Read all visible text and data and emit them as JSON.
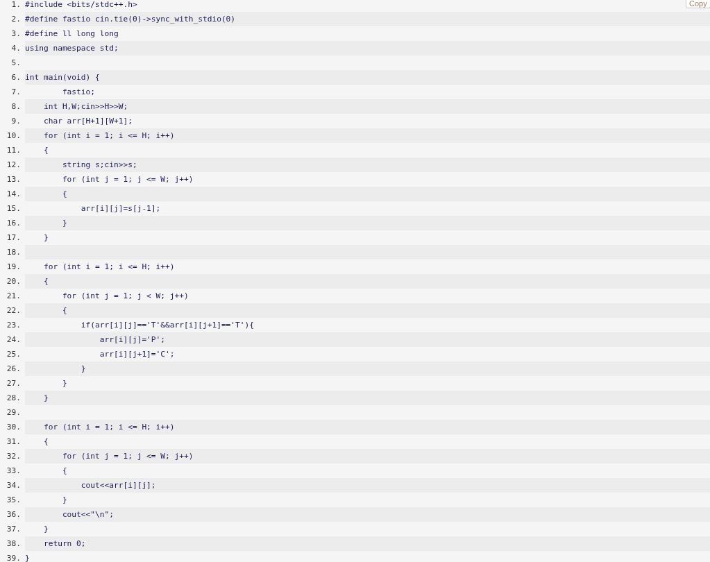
{
  "copy_button": {
    "label": "Copy"
  },
  "lines": [
    {
      "number": "1.",
      "code": "#include <bits/stdc++.h>"
    },
    {
      "number": "2.",
      "code": "#define fastio cin.tie(0)->sync_with_stdio(0)"
    },
    {
      "number": "3.",
      "code": "#define ll long long"
    },
    {
      "number": "4.",
      "code": "using namespace std;"
    },
    {
      "number": "5."
    },
    {
      "number": "6.",
      "code": "int main(void) {"
    },
    {
      "number": "7.",
      "code": "        fastio;"
    },
    {
      "number": "8.",
      "code": "    int H,W;cin>>H>>W;"
    },
    {
      "number": "9.",
      "code": "    char arr[H+1][W+1];"
    },
    {
      "number": "10.",
      "code": "    for (int i = 1; i <= H; i++)"
    },
    {
      "number": "11.",
      "code": "    {"
    },
    {
      "number": "12.",
      "code": "        string s;cin>>s;"
    },
    {
      "number": "13.",
      "code": "        for (int j = 1; j <= W; j++)"
    },
    {
      "number": "14.",
      "code": "        {"
    },
    {
      "number": "15.",
      "code": "            arr[i][j]=s[j-1];"
    },
    {
      "number": "16.",
      "code": "        }"
    },
    {
      "number": "17.",
      "code": "    }"
    },
    {
      "number": "18."
    },
    {
      "number": "19.",
      "code": "    for (int i = 1; i <= H; i++)"
    },
    {
      "number": "20.",
      "code": "    {"
    },
    {
      "number": "21.",
      "code": "        for (int j = 1; j < W; j++)"
    },
    {
      "number": "22.",
      "code": "        {"
    },
    {
      "number": "23.",
      "code": "            if(arr[i][j]=='T'&&arr[i][j+1]=='T'){"
    },
    {
      "number": "24.",
      "code": "                arr[i][j]='P';"
    },
    {
      "number": "25.",
      "code": "                arr[i][j+1]='C';"
    },
    {
      "number": "26.",
      "code": "            }"
    },
    {
      "number": "27.",
      "code": "        }"
    },
    {
      "number": "28.",
      "code": "    }"
    },
    {
      "number": "29."
    },
    {
      "number": "30.",
      "code": "    for (int i = 1; i <= H; i++)"
    },
    {
      "number": "31.",
      "code": "    {"
    },
    {
      "number": "32.",
      "code": "        for (int j = 1; j <= W; j++)"
    },
    {
      "number": "33.",
      "code": "        {"
    },
    {
      "number": "34.",
      "code": "            cout<<arr[i][j];"
    },
    {
      "number": "35.",
      "code": "        }"
    },
    {
      "number": "36.",
      "code": "        cout<<\"\\n\";"
    },
    {
      "number": "37.",
      "code": "    }"
    },
    {
      "number": "38.",
      "code": "    return 0;"
    },
    {
      "number": "39.",
      "code": "}"
    }
  ]
}
